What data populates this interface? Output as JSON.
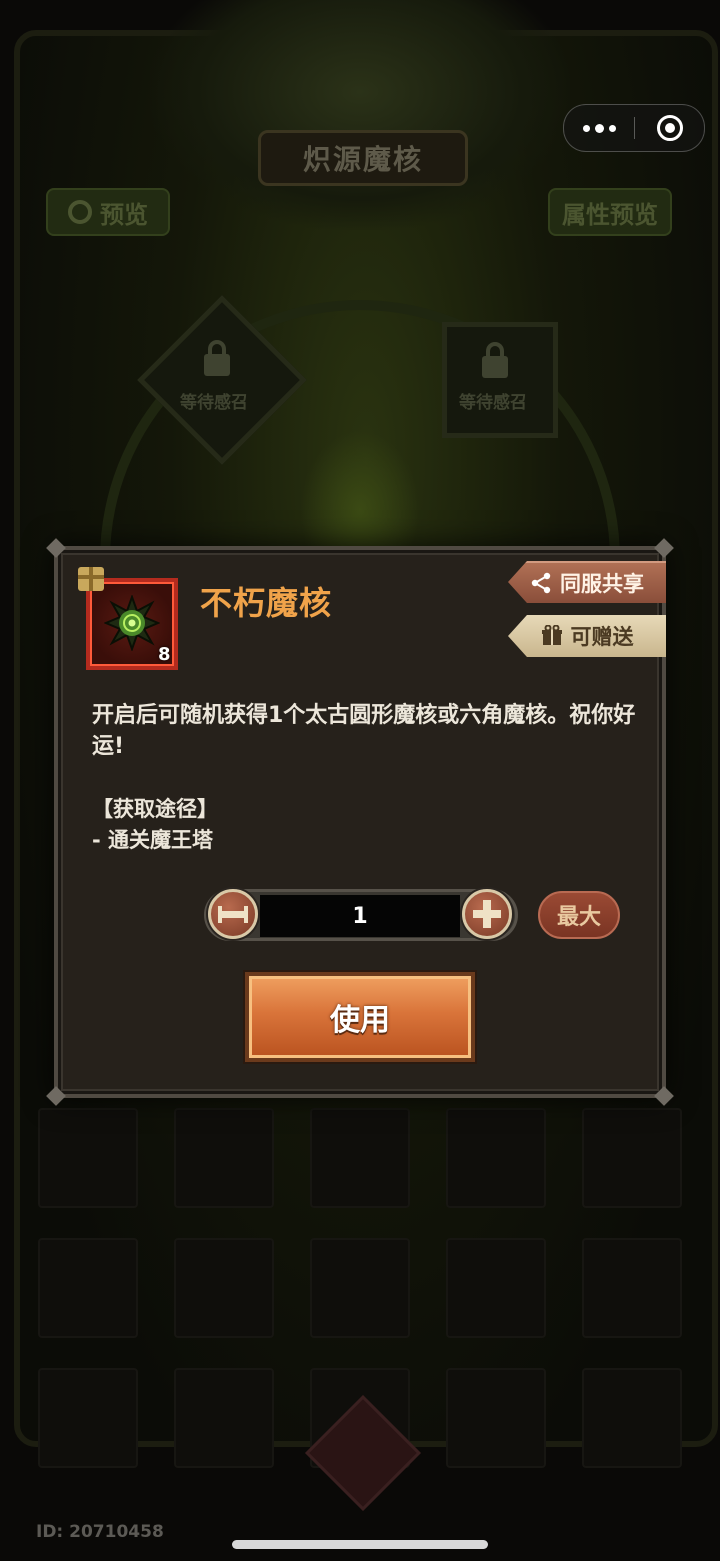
{
  "background": {
    "title": "炽源魔核",
    "preview_button": "预览",
    "attr_preview_button": "属性预览",
    "slot_left_label": "等待感召",
    "slot_right_label": "等待感召",
    "user_id": "ID: 20710458"
  },
  "capsule": {
    "more_icon": "more-dots-icon",
    "close_icon": "target-icon"
  },
  "modal": {
    "item_name": "不朽魔核",
    "item_count": "8",
    "share_button": "同服共享",
    "gift_button": "可赠送",
    "description": "开启后可随机获得1个太古圆形魔核或六角魔核。祝你好运!",
    "source_title": "【获取途径】",
    "source_item": "- 通关魔王塔",
    "quantity": "1",
    "max_button": "最大",
    "use_button": "使用"
  },
  "colors": {
    "item_name": "#f0a34a",
    "rarity_frame": "#b42b1e",
    "use_button": "#d9743a"
  }
}
